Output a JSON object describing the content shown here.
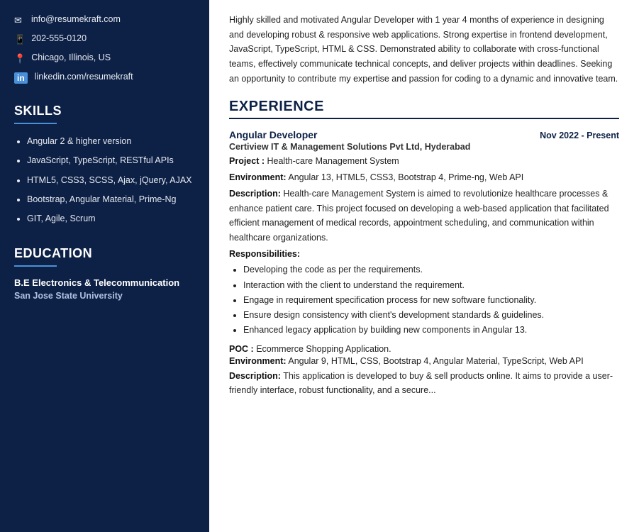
{
  "sidebar": {
    "contact": {
      "email": "info@resumekraft.com",
      "phone": "202-555-0120",
      "location": "Chicago, Illinois, US",
      "linkedin": "linkedin.com/resumekraft"
    },
    "skills_title": "SKILLS",
    "skills": [
      "Angular 2 & higher version",
      "JavaScript, TypeScript, RESTful APIs",
      "HTML5, CSS3, SCSS, Ajax, jQuery, AJAX",
      "Bootstrap, Angular Material, Prime-Ng",
      "GIT, Agile, Scrum"
    ],
    "education_title": "EDUCATION",
    "education": [
      {
        "degree": "B.E Electronics & Telecommunication",
        "institution": "San Jose State University"
      }
    ]
  },
  "main": {
    "summary": "Highly skilled and motivated Angular Developer with 1 year 4 months of experience in designing and developing robust & responsive web applications. Strong expertise in frontend development, JavaScript, TypeScript, HTML & CSS. Demonstrated ability to collaborate with cross-functional teams, effectively communicate technical concepts, and deliver projects within deadlines. Seeking an opportunity to contribute my expertise and passion for coding to a dynamic and innovative team.",
    "experience_title": "EXPERIENCE",
    "jobs": [
      {
        "title": "Angular Developer",
        "date": "Nov 2022 - Present",
        "company": "Certiview IT & Management Solutions Pvt Ltd, Hyderabad",
        "project": "Health-care Management System",
        "environment": "Angular 13, HTML5, CSS3, Bootstrap 4, Prime-ng, Web API",
        "description": "Health-care Management System is aimed to revolutionize healthcare processes & enhance patient care. This project focused on developing a web-based application that facilitated efficient management of medical records, appointment scheduling, and communication within healthcare organizations.",
        "responsibilities_title": "Responsibilities:",
        "responsibilities": [
          "Developing the code as per the requirements.",
          "Interaction with the client to understand the requirement.",
          "Engage in requirement specification process for new software functionality.",
          "Ensure design consistency with client's development standards & guidelines.",
          "Enhanced legacy application by building new components in Angular 13."
        ],
        "poc": "Ecommerce Shopping Application.",
        "poc_environment": "Angular 9, HTML, CSS, Bootstrap 4, Angular Material, TypeScript, Web API",
        "poc_description": "This application is developed to buy & sell products online. It aims to provide a user-friendly interface, robust functionality, and a secure..."
      }
    ]
  },
  "icons": {
    "email": "✉",
    "phone": "📱",
    "location": "📍",
    "linkedin": "in"
  }
}
